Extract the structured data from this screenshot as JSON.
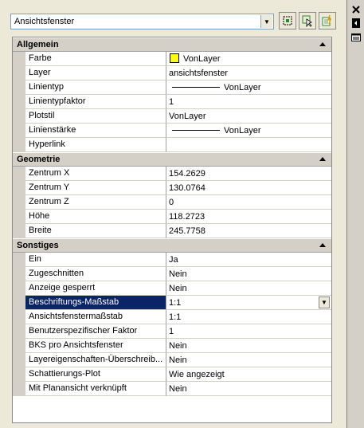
{
  "selector": {
    "value": "Ansichtsfenster"
  },
  "toolbar": {
    "icons": [
      "quick-select-icon",
      "select-objects-icon",
      "toggle-pickadd-icon"
    ]
  },
  "categories": [
    {
      "title": "Allgemein",
      "rows": [
        {
          "name": "Farbe",
          "value": "VonLayer",
          "swatch": "#ffff00"
        },
        {
          "name": "Layer",
          "value": "ansichtsfenster"
        },
        {
          "name": "Linientyp",
          "value": "VonLayer",
          "line": true
        },
        {
          "name": "Linientypfaktor",
          "value": "1"
        },
        {
          "name": "Plotstil",
          "value": "VonLayer"
        },
        {
          "name": "Linienstärke",
          "value": "VonLayer",
          "line": true
        },
        {
          "name": "Hyperlink",
          "value": ""
        }
      ]
    },
    {
      "title": "Geometrie",
      "rows": [
        {
          "name": "Zentrum X",
          "value": "154.2629"
        },
        {
          "name": "Zentrum Y",
          "value": "130.0764"
        },
        {
          "name": "Zentrum Z",
          "value": "0"
        },
        {
          "name": "Höhe",
          "value": "118.2723"
        },
        {
          "name": "Breite",
          "value": "245.7758"
        }
      ]
    },
    {
      "title": "Sonstiges",
      "rows": [
        {
          "name": "Ein",
          "value": "Ja"
        },
        {
          "name": "Zugeschnitten",
          "value": "Nein"
        },
        {
          "name": "Anzeige gesperrt",
          "value": "Nein"
        },
        {
          "name": "Beschriftungs-Maßstab",
          "value": "1:1",
          "selected": true
        },
        {
          "name": "Ansichtsfenstermaßstab",
          "value": "1:1"
        },
        {
          "name": "Benutzerspezifischer Faktor",
          "value": "1"
        },
        {
          "name": "BKS pro Ansichtsfenster",
          "value": "Nein"
        },
        {
          "name": "Layereigenschaften-Überschreib...",
          "value": "Nein"
        },
        {
          "name": "Schattierungs-Plot",
          "value": "Wie angezeigt"
        },
        {
          "name": "Mit Planansicht verknüpft",
          "value": "Nein"
        }
      ]
    }
  ],
  "sidebar": {
    "icons": [
      "close-icon",
      "auto-hide-icon",
      "properties-menu-icon"
    ]
  }
}
